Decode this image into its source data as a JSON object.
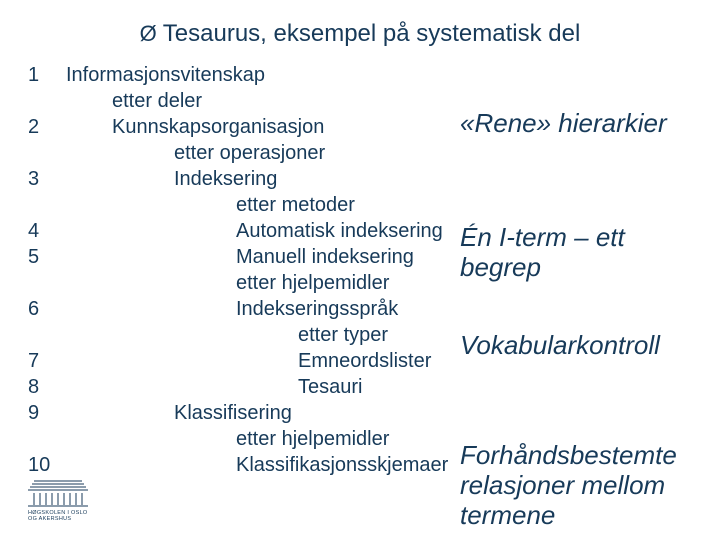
{
  "title": "Tesaurus, eksempel på systematisk del",
  "rows": [
    {
      "num": "1",
      "label": "Informasjonsvitenskap",
      "indent": 0
    },
    {
      "num": "",
      "label": "etter deler",
      "indent": 1
    },
    {
      "num": "2",
      "label": "Kunnskapsorganisasjon",
      "indent": 1
    },
    {
      "num": "",
      "label": "etter operasjoner",
      "indent": 2
    },
    {
      "num": "3",
      "label": "Indeksering",
      "indent": 2
    },
    {
      "num": "",
      "label": "etter metoder",
      "indent": 3
    },
    {
      "num": "4",
      "label": "Automatisk indeksering",
      "indent": 3
    },
    {
      "num": "5",
      "label": "Manuell indeksering",
      "indent": 3
    },
    {
      "num": "",
      "label": "etter hjelpemidler",
      "indent": 3
    },
    {
      "num": "6",
      "label": "Indekseringsspråk",
      "indent": 3
    },
    {
      "num": "",
      "label": "etter typer",
      "indent": 4
    },
    {
      "num": "7",
      "label": "Emneordslister",
      "indent": 4
    },
    {
      "num": "8",
      "label": "Tesauri",
      "indent": 4
    },
    {
      "num": "9",
      "label": "Klassifisering",
      "indent": 2
    },
    {
      "num": "",
      "label": "etter hjelpemidler",
      "indent": 3
    },
    {
      "num": "10",
      "label": "Klassifikasjonsskjemaer",
      "indent": 3
    }
  ],
  "annotations": {
    "a1": "«Rene» hierarkier",
    "a2": "Én I-term – ett begrep",
    "a3": "Vokabularkontroll",
    "a4": "Forhåndsbestemte relasjoner mellom termene"
  },
  "logo_text": "HØGSKOLEN I OSLO OG AKERSHUS",
  "colors": {
    "text": "#173a59"
  }
}
